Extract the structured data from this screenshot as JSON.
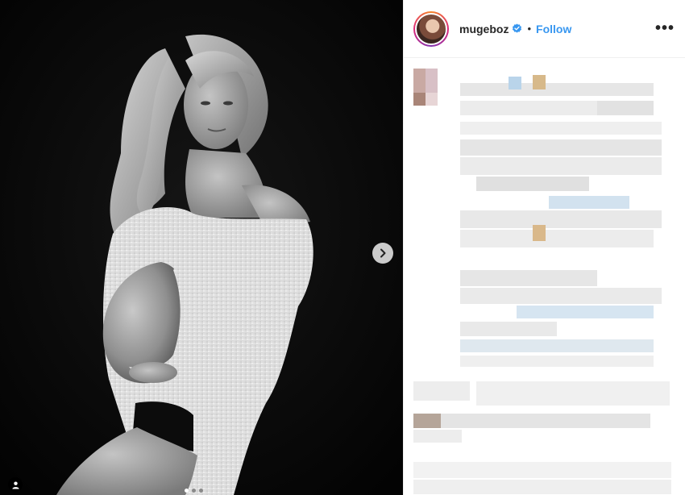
{
  "post": {
    "username": "mugeboz",
    "separator": "•",
    "follow_label": "Follow",
    "more_label": "•••",
    "verified": true,
    "carousel": {
      "slide_count": 3,
      "active_slide": 1
    }
  },
  "colors": {
    "follow": "#3897f0",
    "verified": "#3897f0",
    "media_background": "#060606"
  },
  "icons": {
    "next": "chevron-right-icon",
    "tag": "user-tag-icon",
    "verified": "verified-badge-icon",
    "more": "more-options-icon"
  }
}
